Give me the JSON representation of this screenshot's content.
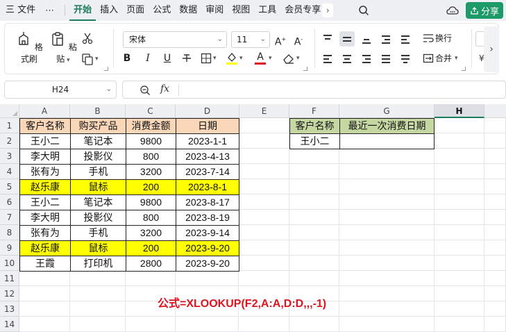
{
  "menu": {
    "menu_icon": "hamburger-icon",
    "file": "三 文件",
    "more": "⋯",
    "tabs": [
      "开始",
      "插入",
      "页面",
      "公式",
      "数据",
      "审阅",
      "视图",
      "工具",
      "会员专享"
    ],
    "active_tab": "开始",
    "share": "分享"
  },
  "ribbon": {
    "format_painter": "格式刷",
    "paste": "粘贴",
    "font_name": "宋体",
    "font_size": "11",
    "wrap": "换行",
    "merge": "合并",
    "bold": "B",
    "italic": "I",
    "underline": "U"
  },
  "formula_bar": {
    "cell_ref": "H24",
    "fx": "fx",
    "content": ""
  },
  "grid": {
    "columns": [
      "A",
      "B",
      "C",
      "D",
      "E",
      "F",
      "G",
      "H"
    ],
    "selected_column": "H",
    "rows": [
      "1",
      "2",
      "3",
      "4",
      "5",
      "6",
      "7",
      "8",
      "9",
      "10",
      "11",
      "12",
      "13",
      "14"
    ],
    "table1_header": [
      "客户名称",
      "购买产品",
      "消费金额",
      "日期"
    ],
    "table1_rows": [
      [
        "王小二",
        "笔记本",
        "9800",
        "2023-1-1"
      ],
      [
        "李大明",
        "投影仪",
        "800",
        "2023-4-13"
      ],
      [
        "张有为",
        "手机",
        "3200",
        "2023-7-14"
      ],
      [
        "赵乐康",
        "鼠标",
        "200",
        "2023-8-1"
      ],
      [
        "王小二",
        "笔记本",
        "9800",
        "2023-8-17"
      ],
      [
        "李大明",
        "投影仪",
        "800",
        "2023-8-19"
      ],
      [
        "张有为",
        "手机",
        "3200",
        "2023-9-14"
      ],
      [
        "赵乐康",
        "鼠标",
        "200",
        "2023-9-20"
      ],
      [
        "王霞",
        "打印机",
        "2800",
        "2023-9-20"
      ]
    ],
    "highlight_rows": [
      3,
      7
    ],
    "highlight_color": "#ffff00",
    "header_color_a": "#f9d7b8",
    "header_color_f": "#c6d8a2",
    "table2_header": [
      "客户名称",
      "最近一次消费日期"
    ],
    "table2_row": [
      "王小二",
      ""
    ],
    "formula_note": "公式=XLOOKUP(F2,A:A,D:D,,,-1)"
  }
}
